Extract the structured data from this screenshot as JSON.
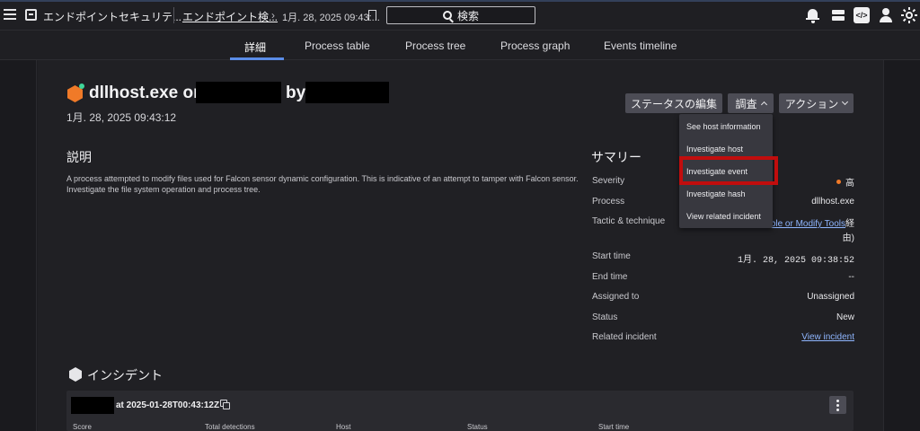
{
  "topbar": {
    "app_title": "エンドポイントセキュリテ...",
    "breadcrumb_link": "エンドポイント検...",
    "breadcrumb_arrow": "›",
    "breadcrumb_current": "1月. 28, 2025 09:43:...",
    "search_label": "検索",
    "icons": [
      "menu-icon",
      "app-icon",
      "bookmark-icon",
      "search-icon",
      "bell-icon",
      "cards-icon",
      "code-icon",
      "user-icon",
      "sun-icon"
    ]
  },
  "tabs": [
    {
      "label": "詳細",
      "active": true
    },
    {
      "label": "Process table",
      "active": false
    },
    {
      "label": "Process tree",
      "active": false
    },
    {
      "label": "Process graph",
      "active": false
    },
    {
      "label": "Events timeline",
      "active": false
    }
  ],
  "detection": {
    "title_prefix": "dllhost.exe on",
    "title_mid": "by",
    "date": "1月. 28, 2025 09:43:12"
  },
  "actions": {
    "status_edit": "ステータスの編集",
    "investigate": "調査",
    "action": "アクション"
  },
  "dropdown": {
    "items": [
      "See host information",
      "Investigate host",
      "Investigate event",
      "Investigate hash",
      "View related incident"
    ],
    "highlighted": "Investigate event",
    "highlight_color": "#c10d0d"
  },
  "description": {
    "heading": "説明",
    "text": "A process attempted to modify files used for Falcon sensor dynamic configuration. This is indicative of an attempt to tamper with Falcon sensor. Investigate the file system operation and process tree."
  },
  "summary": {
    "heading": "サマリー",
    "severity_label": "Severity",
    "severity_value": "高",
    "severity_color": "#f07a28",
    "process_label": "Process",
    "process_value": "dllhost.exe",
    "tactic_label": "Tactic & technique",
    "tactic_value_line1": "ble or Modify Tools",
    "tactic_value_line1_suffix": "経",
    "tactic_value_line2": "由)",
    "start_label": "Start time",
    "start_value": "1月. 28, 2025 09:38:52",
    "end_label": "End time",
    "end_value": "--",
    "assigned_label": "Assigned to",
    "assigned_value": "Unassigned",
    "status_label": "Status",
    "status_value": "New",
    "related_label": "Related incident",
    "related_value": "View incident"
  },
  "incident": {
    "heading": "インシデント",
    "time_text": "at 2025-01-28T00:43:12Z",
    "columns": [
      "Score",
      "Total detections",
      "Host",
      "Status",
      "Start time"
    ]
  },
  "colors": {
    "accent": "#5b8de8",
    "link": "#8fb6ff",
    "status_indicator": "#3fd69a"
  }
}
